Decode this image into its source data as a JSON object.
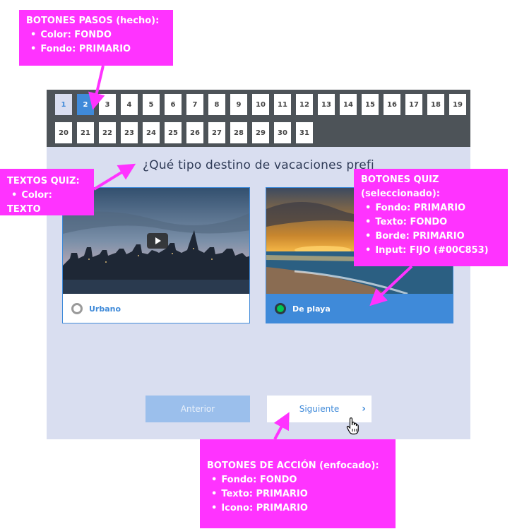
{
  "steps": {
    "row1": [
      "1",
      "2",
      "3",
      "4",
      "5",
      "6",
      "7",
      "8",
      "9",
      "10",
      "11",
      "12",
      "13",
      "14",
      "15",
      "16",
      "17",
      "18",
      "19"
    ],
    "row2": [
      "20",
      "21",
      "22",
      "23",
      "24",
      "25",
      "26",
      "27",
      "28",
      "29",
      "30",
      "31"
    ],
    "done_index": 0,
    "current_index": 1
  },
  "quiz": {
    "question": "¿Qué tipo destino de vacaciones prefi",
    "options": [
      {
        "label": "Urbano",
        "selected": false,
        "icon": "play-icon"
      },
      {
        "label": "De playa",
        "selected": true
      }
    ],
    "prev_label": "Anterior",
    "next_label": "Siguiente",
    "next_icon": "chevron-right-icon"
  },
  "callouts": {
    "pasos": {
      "title": "BOTONES PASOS  (hecho):",
      "items": [
        "Color: FONDO",
        "Fondo: PRIMARIO"
      ]
    },
    "textos": {
      "title": "TEXTOS QUIZ:",
      "items": [
        "Color: TEXTO"
      ]
    },
    "quiz_btn": {
      "title": "BOTONES QUIZ",
      "subtitle": "(seleccionado):",
      "items": [
        "Fondo: PRIMARIO",
        "Texto: FONDO",
        "Borde: PRIMARIO",
        "Input: FIJO (#00C853)"
      ]
    },
    "accion": {
      "title": "BOTONES DE ACCIÓN (enfocado):",
      "items": [
        "Fondo: FONDO",
        "Texto: PRIMARIO",
        "Icono: PRIMARIO"
      ]
    }
  },
  "colors": {
    "primary": "#3f8ad9",
    "background": "#d9def0",
    "stepbar": "#4d5358",
    "annotation": "#ff33ff",
    "input_fixed": "#00c853",
    "prev_disabled": "#9bbfec"
  }
}
